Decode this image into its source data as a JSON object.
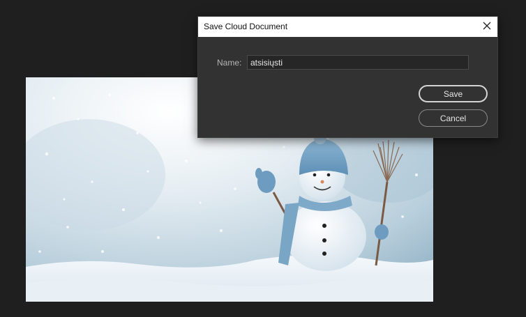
{
  "canvas": {
    "image_subject": "snowman in snowy landscape"
  },
  "dialog": {
    "title": "Save Cloud Document",
    "close_icon": "close-icon",
    "name_label": "Name:",
    "name_value": "atsisiųsti",
    "save_label": "Save",
    "cancel_label": "Cancel"
  },
  "colors": {
    "app_background": "#1f1f1f",
    "dialog_background": "#323232",
    "titlebar_background": "#ffffff"
  }
}
